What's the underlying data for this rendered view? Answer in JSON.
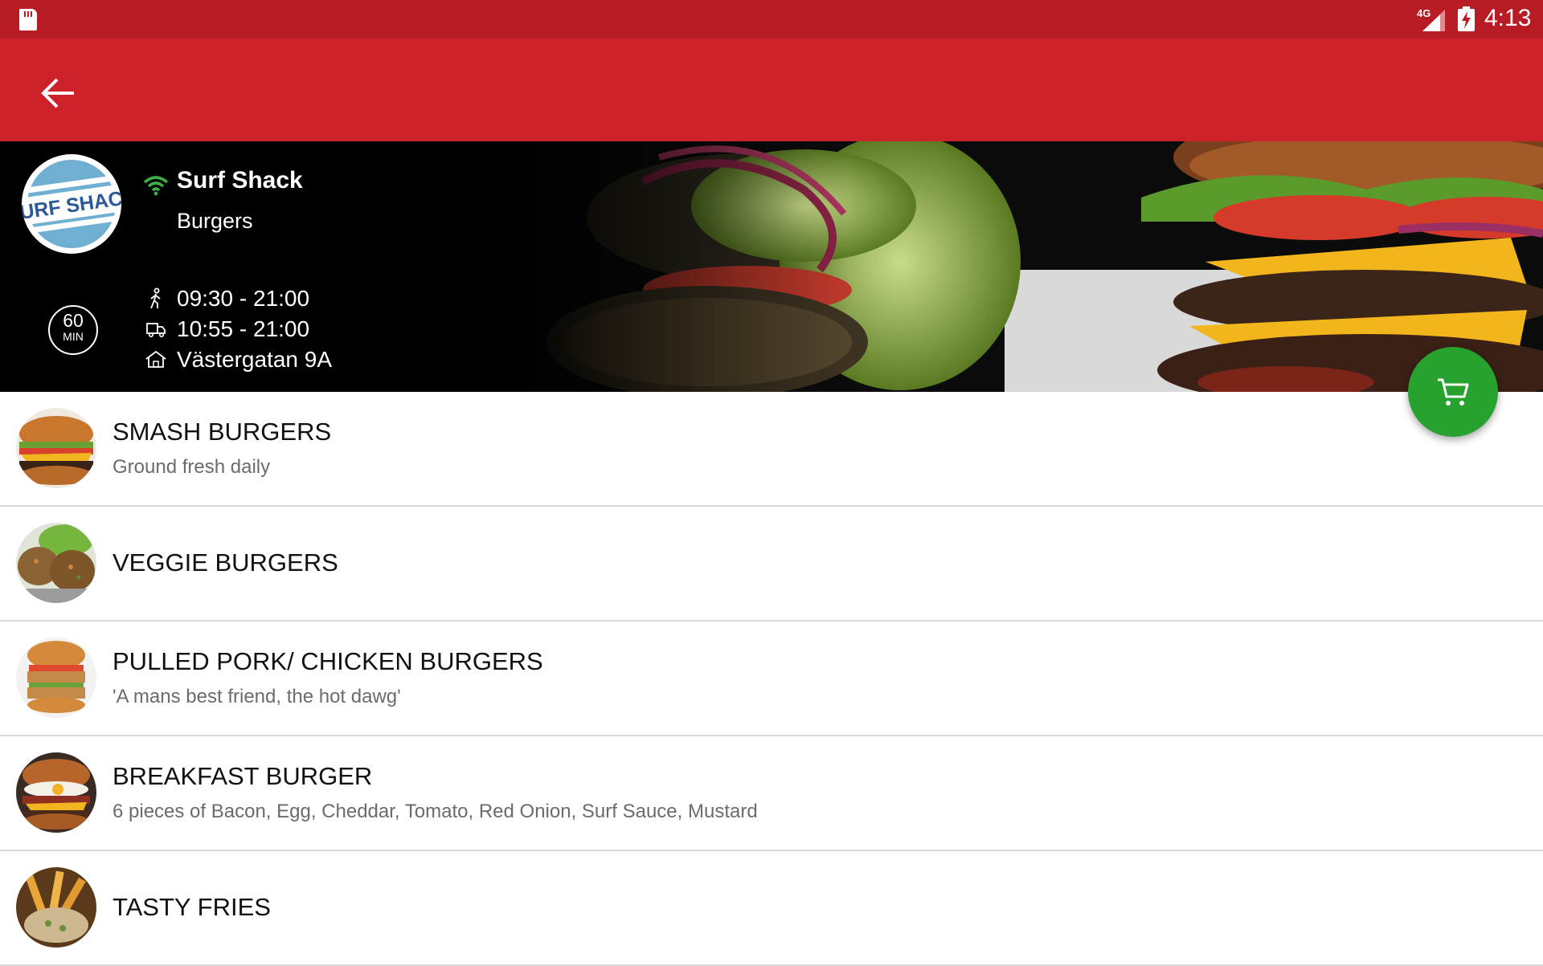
{
  "status_bar": {
    "network": "4G",
    "time": "4:13",
    "icons": [
      "sd-card-icon",
      "signal-icon",
      "battery-charging-icon"
    ]
  },
  "toolbar": {
    "back_icon": "arrow-back-icon"
  },
  "restaurant": {
    "name": "Surf Shack",
    "category": "Burgers",
    "logo_text": "SURF SHACK",
    "online_icon": "wifi-icon",
    "eta_value": "60",
    "eta_unit": "MIN",
    "pickup_hours": "09:30 - 21:00",
    "delivery_hours": "10:55 - 21:00",
    "address": "Västergatan 9A"
  },
  "cart": {
    "icon": "cart-icon"
  },
  "menu": {
    "items": [
      {
        "title": "SMASH BURGERS",
        "description": "Ground fresh daily"
      },
      {
        "title": "VEGGIE BURGERS",
        "description": ""
      },
      {
        "title": "PULLED PORK/ CHICKEN BURGERS",
        "description": "'A mans best friend, the hot dawg'"
      },
      {
        "title": "BREAKFAST BURGER",
        "description": "6 pieces of Bacon, Egg, Cheddar, Tomato, Red Onion, Surf Sauce, Mustard"
      },
      {
        "title": "TASTY FRIES",
        "description": ""
      }
    ]
  },
  "colors": {
    "status_bar": "#b71c24",
    "toolbar": "#cd212a",
    "fab": "#27a22e",
    "online": "#3cb043"
  }
}
